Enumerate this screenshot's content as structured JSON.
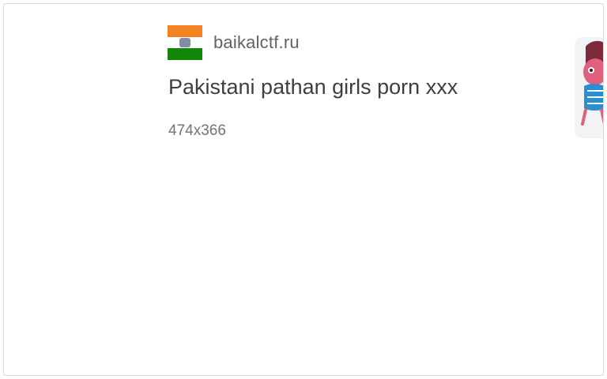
{
  "result": {
    "source": "baikalctf.ru",
    "favicon_icon": "india-flag-icon",
    "favicon_colors": [
      "#f58220",
      "#ffffff",
      "#138808"
    ],
    "title": "Pakistani pathan girls porn xxx",
    "dimensions": "474x366"
  },
  "side_thumbnail": {
    "icon": "cartoon-character-thumbnail",
    "colors": [
      "#e0607e",
      "#2a8fd0",
      "#7a2a3a"
    ]
  }
}
